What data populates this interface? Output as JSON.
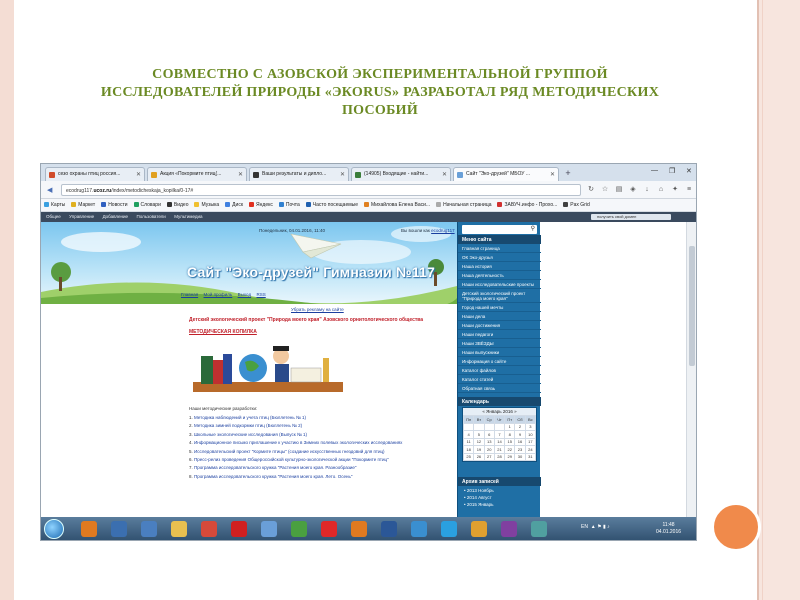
{
  "slide": {
    "title_line1": "СОВМЕСТНО С АЗОВСКОЙ ЭКСПЕРИМЕНТАЛЬНОЙ ГРУППОЙ",
    "title_line2": "ИССЛЕДОВАТЕЛЕЙ ПРИРОДЫ «ЭКОRUS» РАЗРАБОТАЛ РЯД МЕТОДИЧЕСКИХ",
    "title_line3": "ПОСОБИЙ"
  },
  "browser": {
    "tabs": [
      {
        "label": "сезо охраны птиц россия...",
        "color": "#d04b2a"
      },
      {
        "label": "Акция «Покормите птиц(...",
        "color": "#e0a020"
      },
      {
        "label": "Ваши результаты и дипло...",
        "color": "#333333"
      },
      {
        "label": "(14905) Входящие - найти...",
        "color": "#3a7d3a"
      },
      {
        "label": "Сайт \"Эко-друзей\" МБОУ ...",
        "color": "#6aa0d8"
      }
    ],
    "url_host": "ecodrug117.ucoz.ru",
    "url_prefix": "ecodrug117.",
    "url_host_bold": "ucoz.ru",
    "url_path": "/index/metodicheskaja_kopilka/0-17#",
    "bookmarks": [
      {
        "label": "Карты",
        "color": "#3aa0e0"
      },
      {
        "label": "Маркет",
        "color": "#e0b020"
      },
      {
        "label": "Новости",
        "color": "#3060c0"
      },
      {
        "label": "Словари",
        "color": "#20a060"
      },
      {
        "label": "Видео",
        "color": "#333333"
      },
      {
        "label": "Музыка",
        "color": "#f0c030"
      },
      {
        "label": "Диск",
        "color": "#4080e0"
      },
      {
        "label": "Яндекс",
        "color": "#e03020"
      },
      {
        "label": "Почта",
        "color": "#3080d0"
      },
      {
        "label": "Часто посещаемые",
        "color": "#2060b0"
      },
      {
        "label": "Михайлова Елена Васи...",
        "color": "#e08020"
      },
      {
        "label": "Начальная страница",
        "color": "#aaaaaa"
      },
      {
        "label": "ЗАВУЧ.инфо - Прохо...",
        "color": "#d03030"
      },
      {
        "label": "Pax Grid",
        "color": "#404040"
      }
    ],
    "menu_items": [
      "Общее",
      "Управление",
      "Добавление",
      "Пользователи",
      "Мультимедиа"
    ],
    "menu_search": "получить свой домен"
  },
  "site": {
    "date_text": "Понедельник, 04.01.2016, 11:40",
    "login_text": "Вы вошли как",
    "login_user": "ecodrug117",
    "title": "Сайт \"Эко-друзей\" Гимназии №117",
    "nav": [
      "Главная",
      "Мой профиль",
      "Выход",
      "RSS"
    ],
    "ad_link": "Убрать рекламу на сайте",
    "project_title": "Детский экологический проект \"Природа моего края\" Азовского орнитологического общества",
    "kopilka_title": "МЕТОДИЧЕСКАЯ КОПИЛКА",
    "dev_title": "Наши методические разработки:",
    "dev_items": [
      {
        "num": "1.",
        "text": "Методика наблюдений и учета птиц (Бюллетень № 1)"
      },
      {
        "num": "2.",
        "text": "Методика зимней подкормки птиц (Бюллетень № 2)"
      },
      {
        "num": "3.",
        "text": "Школьные экологические исследования (Выпуск № 1)"
      },
      {
        "num": "4.",
        "text": "Информационное письмо приглашение к участию в Зимних полевых экологических исследованиях"
      },
      {
        "num": "5.",
        "text": "Исследовательский проект \"Кормите птицы\" (создание искусственных гнездовий для птиц)"
      },
      {
        "num": "6.",
        "text": "Пресс-релиз проведения Общероссийской культурно-экологической акции \"Покормите птиц\""
      },
      {
        "num": "7.",
        "text": "Программа исследовательского кружка \"Растения моего края. Разнообразие\""
      },
      {
        "num": "8.",
        "text": "Программа исследовательского кружка \"Растения моего края. Лето. Осень\""
      }
    ],
    "sidebar": {
      "menu_title": "Меню сайта",
      "menu_items": [
        "Главная страница",
        "ОК Эко-друзья",
        "Наша история",
        "Наша деятельность",
        "Наши исследовательские проекты",
        "Детский экологический проект \"Природа моего края\"",
        "Город нашей мечты",
        "Наши дела",
        "Наши достижения",
        "Наши педагоги",
        "Наши ЗВЁЗДЫ",
        "Наши выпускники",
        "Информация о сайте",
        "Каталог файлов",
        "Каталог статей",
        "Обратная связь"
      ],
      "calendar_title": "Календарь",
      "calendar_month": "« Январь 2016 »",
      "calendar_days": [
        "Пн",
        "Вт",
        "Ср",
        "Чт",
        "Пт",
        "Сб",
        "Вс"
      ],
      "calendar_weeks": [
        [
          "",
          "",
          "",
          "",
          "1",
          "2",
          "3"
        ],
        [
          "4",
          "5",
          "6",
          "7",
          "8",
          "9",
          "10"
        ],
        [
          "11",
          "12",
          "13",
          "14",
          "15",
          "16",
          "17"
        ],
        [
          "18",
          "19",
          "20",
          "21",
          "22",
          "23",
          "24"
        ],
        [
          "25",
          "26",
          "27",
          "28",
          "29",
          "30",
          "31"
        ]
      ],
      "archive_title": "Архив записей",
      "archive_items": [
        "2013 Ноябрь",
        "2014 Август",
        "2015 Январь"
      ]
    }
  },
  "taskbar": {
    "lang": "EN",
    "time": "11:48",
    "date": "04.01.2016",
    "icons": [
      {
        "name": "media-player-icon",
        "color": "#e07a20"
      },
      {
        "name": "hp-icon",
        "color": "#3b6fb0"
      },
      {
        "name": "mail-icon",
        "color": "#4a7fc0"
      },
      {
        "name": "folder-icon",
        "color": "#e8c050"
      },
      {
        "name": "chrome-icon",
        "color": "#d64a3a"
      },
      {
        "name": "opera-icon",
        "color": "#d02020"
      },
      {
        "name": "paint-icon",
        "color": "#6a9fd8"
      },
      {
        "name": "utorrent-icon",
        "color": "#4aa040"
      },
      {
        "name": "yandex-icon",
        "color": "#e02828"
      },
      {
        "name": "firefox-icon",
        "color": "#e07a20"
      },
      {
        "name": "word-icon",
        "color": "#2b5797"
      },
      {
        "name": "ie-icon",
        "color": "#3a8fd0"
      },
      {
        "name": "skype-icon",
        "color": "#2aa0e0"
      },
      {
        "name": "chat-icon",
        "color": "#e0a030"
      },
      {
        "name": "app-icon",
        "color": "#8040a0"
      },
      {
        "name": "viewer-icon",
        "color": "#50a0a0"
      }
    ]
  },
  "colors": {
    "title": "#6b8a24",
    "accent_circle": "#f08a4b",
    "sidebar": "#1f6fa5",
    "red_heading": "#c0202a"
  }
}
